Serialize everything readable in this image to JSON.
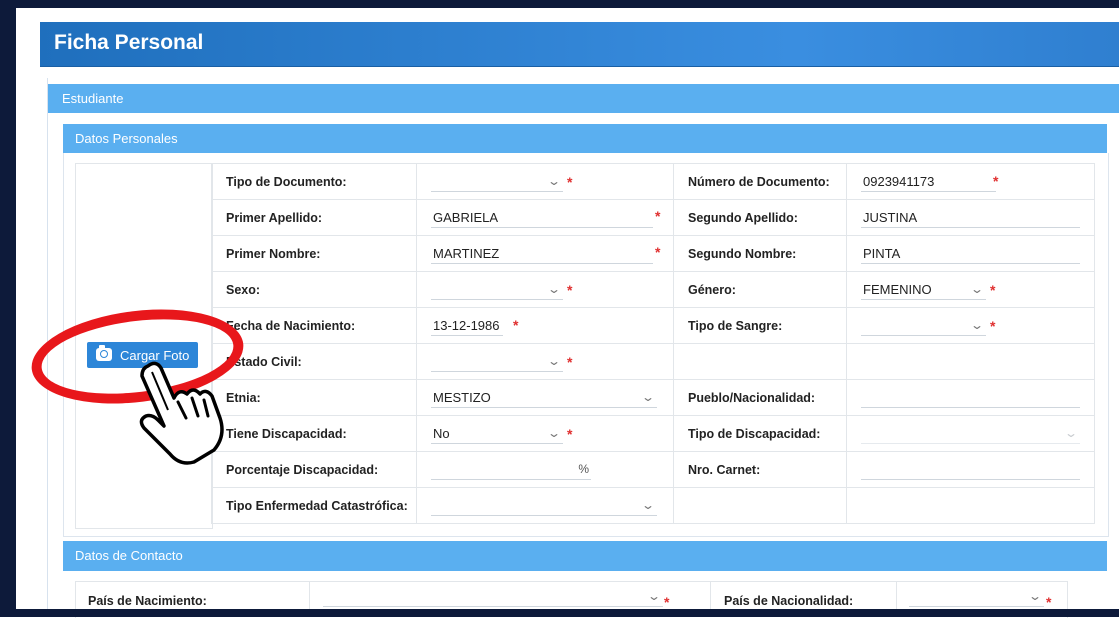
{
  "page": {
    "title": "Ficha Personal"
  },
  "sections": {
    "estudiante": "Estudiante",
    "datos_personales": "Datos Personales",
    "datos_contacto": "Datos de Contacto"
  },
  "photo": {
    "button_label": "Cargar Foto",
    "button_icon": "camera-icon"
  },
  "form": {
    "tipo_documento": {
      "label": "Tipo de Documento:",
      "value": ""
    },
    "numero_documento": {
      "label": "Número de Documento:",
      "value": "0923941173"
    },
    "primer_apellido": {
      "label": "Primer Apellido:",
      "value": "GABRIELA"
    },
    "segundo_apellido": {
      "label": "Segundo Apellido:",
      "value": "JUSTINA"
    },
    "primer_nombre": {
      "label": "Primer Nombre:",
      "value": "MARTINEZ"
    },
    "segundo_nombre": {
      "label": "Segundo Nombre:",
      "value": "PINTA"
    },
    "sexo": {
      "label": "Sexo:",
      "value": ""
    },
    "genero": {
      "label": "Género:",
      "value": "FEMENINO"
    },
    "fecha_nacimiento": {
      "label": "Fecha de Nacimiento:",
      "value": "13-12-1986"
    },
    "tipo_sangre": {
      "label": "Tipo de Sangre:",
      "value": ""
    },
    "estado_civil": {
      "label": "Estado Civil:",
      "value": ""
    },
    "etnia": {
      "label": "Etnia:",
      "value": "MESTIZO"
    },
    "pueblo_nacionalidad": {
      "label": "Pueblo/Nacionalidad:",
      "value": ""
    },
    "tiene_discapacidad": {
      "label": "Tiene Discapacidad:",
      "value": "No"
    },
    "tipo_discapacidad": {
      "label": "Tipo de Discapacidad:",
      "value": ""
    },
    "porcentaje_discapacidad": {
      "label": "Porcentaje Discapacidad:",
      "value": "",
      "suffix": "%"
    },
    "nro_carnet": {
      "label": "Nro. Carnet:",
      "value": ""
    },
    "tipo_enfermedad": {
      "label": "Tipo Enfermedad Catastrófica:",
      "value": ""
    }
  },
  "contacto": {
    "pais_nacimiento": {
      "label": "País de Nacimiento:",
      "value": ""
    },
    "pais_nacionalidad": {
      "label": "País de Nacionalidad:",
      "value": ""
    }
  },
  "symbols": {
    "required": "*",
    "chevron": "⌄"
  },
  "colors": {
    "header": "#2f7fd0",
    "section_bar": "#5aaff0",
    "button": "#2d86d8",
    "required": "#e03030",
    "highlight_ring": "#e8171b"
  }
}
